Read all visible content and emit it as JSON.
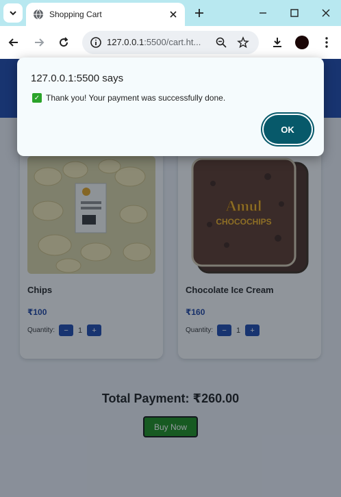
{
  "browser": {
    "tab_title": "Shopping Cart",
    "url_host": "127.0.0.1",
    "url_path": ":5500/cart.ht...",
    "colors": {
      "tabstrip": "#b8e8f0",
      "profile": "#1a0606"
    }
  },
  "page": {
    "header_color": "#1d46a8",
    "products": [
      {
        "name": "Chips",
        "price": "₹100",
        "quantity_label": "Quantity:",
        "quantity": "1",
        "minus": "−",
        "plus": "+"
      },
      {
        "name": "Chocolate Ice Cream",
        "price": "₹160",
        "quantity_label": "Quantity:",
        "quantity": "1",
        "minus": "−",
        "plus": "+"
      }
    ],
    "total": "Total Payment: ₹260.00",
    "buy_label": "Buy Now",
    "image_labels": {
      "brand": "Amul",
      "product": "CHOCOCHIPS"
    }
  },
  "dialog": {
    "origin": "127.0.0.1:5500 says",
    "message": "Thank you! Your payment was successfully done.",
    "ok_label": "OK",
    "accent": "#07596a"
  }
}
